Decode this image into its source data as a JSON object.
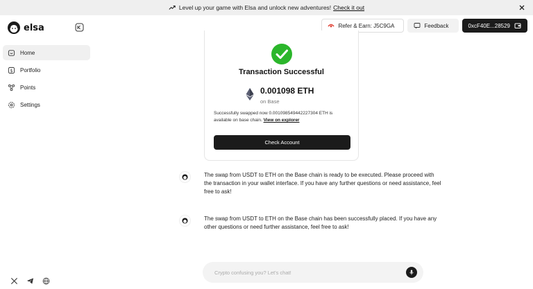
{
  "banner": {
    "text": "Level up your game with Elsa and unlock new adventures!",
    "link": "Check it out"
  },
  "brand": {
    "name": "elsa"
  },
  "header": {
    "refer_label": "Refer & Earn: J5C9GA",
    "feedback_label": "Feedback",
    "wallet_label": "0xcF40E...28529"
  },
  "sidebar": {
    "items": [
      {
        "label": "Home",
        "icon": "home-icon",
        "active": true
      },
      {
        "label": "Portfolio",
        "icon": "portfolio-icon",
        "active": false
      },
      {
        "label": "Points",
        "icon": "points-icon",
        "active": false
      },
      {
        "label": "Settings",
        "icon": "settings-icon",
        "active": false
      }
    ]
  },
  "social": [
    "x-icon",
    "telegram-icon",
    "globe-icon"
  ],
  "transaction": {
    "title": "Transaction Successful",
    "amount": "0.001098 ETH",
    "chain": "on Base",
    "desc_text": "Successfully swapped now 0.001098549442227304 ETH is available on base chain.",
    "explorer_link": "View on explorer",
    "button": "Check Account"
  },
  "messages": [
    {
      "text": "The swap from USDT to ETH on the Base chain is ready to be executed. Please proceed with the transaction in your wallet interface. If you have any further questions or need assistance, feel free to ask!"
    },
    {
      "text": "The swap from USDT to ETH on the Base chain has been successfully placed. If you have any other questions or need further assistance, feel free to ask!"
    }
  ],
  "chat": {
    "placeholder": "Crypto confusing you? Let's chat!"
  },
  "colors": {
    "success": "#2bb62b",
    "dark": "#1b1b1b",
    "accent_red": "#e0463a"
  }
}
